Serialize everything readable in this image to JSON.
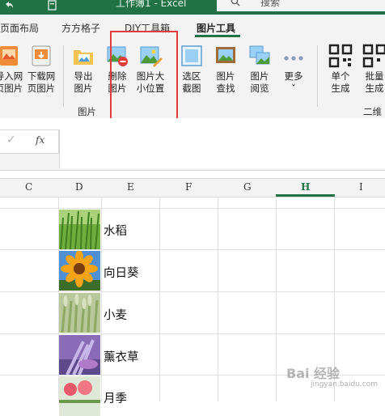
{
  "window": {
    "title": "工作簿1 - Excel",
    "search_placeholder": "搜索"
  },
  "tabs": [
    "页面布局",
    "方方格子",
    "DIY工具箱",
    "图片工具"
  ],
  "active_tab": "图片工具",
  "ribbon": {
    "buttons": [
      {
        "label": "导入网\n页图片",
        "icon": "import-web-image-icon"
      },
      {
        "label": "下载网\n页图片",
        "icon": "download-web-image-icon"
      },
      {
        "label": "导出\n图片",
        "icon": "export-image-icon"
      },
      {
        "label": "删除\n图片",
        "icon": "delete-image-icon"
      },
      {
        "label": "图片大\n小位置",
        "icon": "image-size-position-icon"
      },
      {
        "label": "选区\n截图",
        "icon": "selection-screenshot-icon"
      },
      {
        "label": "图片\n查找",
        "icon": "image-find-icon"
      },
      {
        "label": "图片\n阅览",
        "icon": "image-browse-icon"
      },
      {
        "label": "更多\n˅",
        "icon": "more-dots-icon"
      },
      {
        "label": "单个\n生成",
        "icon": "qr-single-icon"
      },
      {
        "label": "批量\n生成",
        "icon": "qr-batch-icon"
      }
    ],
    "groups": [
      "图片",
      "二维码"
    ]
  },
  "formula_bar": {
    "check": "✓",
    "fx": "fx",
    "value": ""
  },
  "columns": [
    "C",
    "D",
    "E",
    "F",
    "G",
    "H",
    "I"
  ],
  "active_column": "H",
  "rows": [
    {
      "name": "水稻",
      "thumb": "rice-plant"
    },
    {
      "name": "向日葵",
      "thumb": "sunflower"
    },
    {
      "name": "小麦",
      "thumb": "wheat"
    },
    {
      "name": "薰衣草",
      "thumb": "lavender"
    },
    {
      "name": "月季",
      "thumb": "rose"
    }
  ],
  "watermark": {
    "text": "Bai 经验",
    "sub": "jingyan.baidu.com"
  },
  "colors": {
    "excel_green": "#217346",
    "highlight_red": "#e23b3b"
  }
}
